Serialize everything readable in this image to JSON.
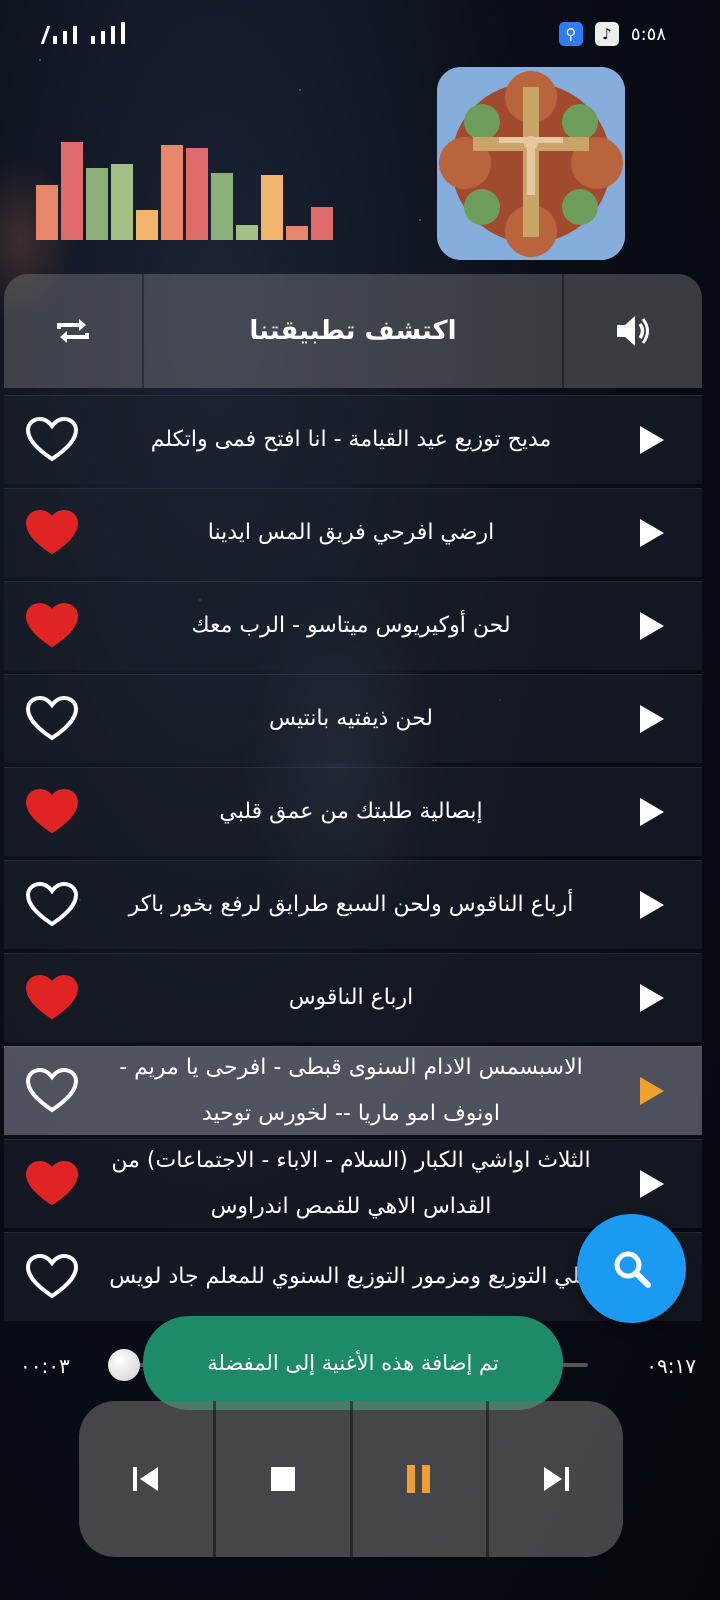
{
  "status_bar": {
    "time": "٥:٥٨"
  },
  "header": {
    "discover_label": "اكتشف تطبيقتنا"
  },
  "songs": [
    {
      "title": "مديح توزيع عيد القيامة - انا افتح فمى واتكلم",
      "favorite": false,
      "playing": false
    },
    {
      "title": "ارضي افرحي فريق المس ايدينا",
      "favorite": true,
      "playing": false
    },
    {
      "title": "لحن أوكيريوس ميتاسو - الرب معك",
      "favorite": true,
      "playing": false
    },
    {
      "title": "لحن ذيفتيه بانتيس",
      "favorite": false,
      "playing": false
    },
    {
      "title": "إبصالية طلبتك من عمق قلبي",
      "favorite": true,
      "playing": false
    },
    {
      "title": "أرباع الناقوس ولحن السبع طرايق لرفع بخور باكر",
      "favorite": false,
      "playing": false
    },
    {
      "title": "ارباع الناقوس",
      "favorite": true,
      "playing": false
    },
    {
      "title": "الاسبسمس الادام السنوى قبطى - افرحى يا مريم - اونوف امو ماريا -- لخورس توحيد",
      "favorite": false,
      "playing": true
    },
    {
      "title": "الثلاث اواشي الكبار (السلام - الاباء - الاجتماعات) من القداس الاهي للقمص اندراوس",
      "favorite": true,
      "playing": false
    },
    {
      "title": "اللي التوزيع ومزمور التوزيع السنوي للمعلم جاد لويس",
      "favorite": false,
      "playing": false
    }
  ],
  "progress": {
    "elapsed": "٠٠:٠٣",
    "total": "٠٩:١٧",
    "fraction": 0.005
  },
  "toast": {
    "message": "تم إضافة هذه الأغنية إلى المفضلة"
  },
  "colors": {
    "heart": "#e02424",
    "accent": "#f0a030",
    "fab": "#1a9af0",
    "toast": "#1d8a6a"
  },
  "eq_levels": [
    0.55,
    0.98,
    0.72,
    0.76,
    0.3,
    0.95,
    0.92,
    0.67,
    0.15,
    0.65,
    0.14,
    0.33
  ],
  "eq_colors": [
    "#e8866a",
    "#e06b6b",
    "#8db07a",
    "#a5c087",
    "#f2b36a",
    "#e8866a",
    "#e06b6b",
    "#8db07a",
    "#a5c087",
    "#f2b36a",
    "#e8866a",
    "#e06b6b"
  ]
}
